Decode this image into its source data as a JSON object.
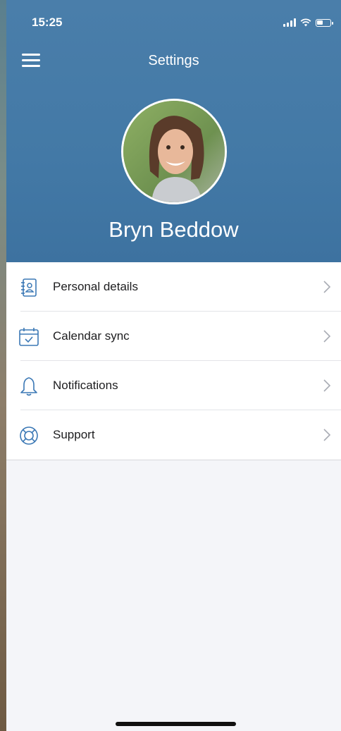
{
  "status_bar": {
    "time": "15:25"
  },
  "header": {
    "title": "Settings",
    "user_name": "Bryn Beddow"
  },
  "menu": {
    "items": [
      {
        "label": "Personal details",
        "icon": "contact-card-icon"
      },
      {
        "label": "Calendar sync",
        "icon": "calendar-check-icon"
      },
      {
        "label": "Notifications",
        "icon": "bell-icon"
      },
      {
        "label": "Support",
        "icon": "lifebuoy-icon"
      }
    ]
  },
  "colors": {
    "header_bg": "#4379a6",
    "icon_blue": "#3b78b5",
    "page_bg": "#f4f5f9"
  }
}
